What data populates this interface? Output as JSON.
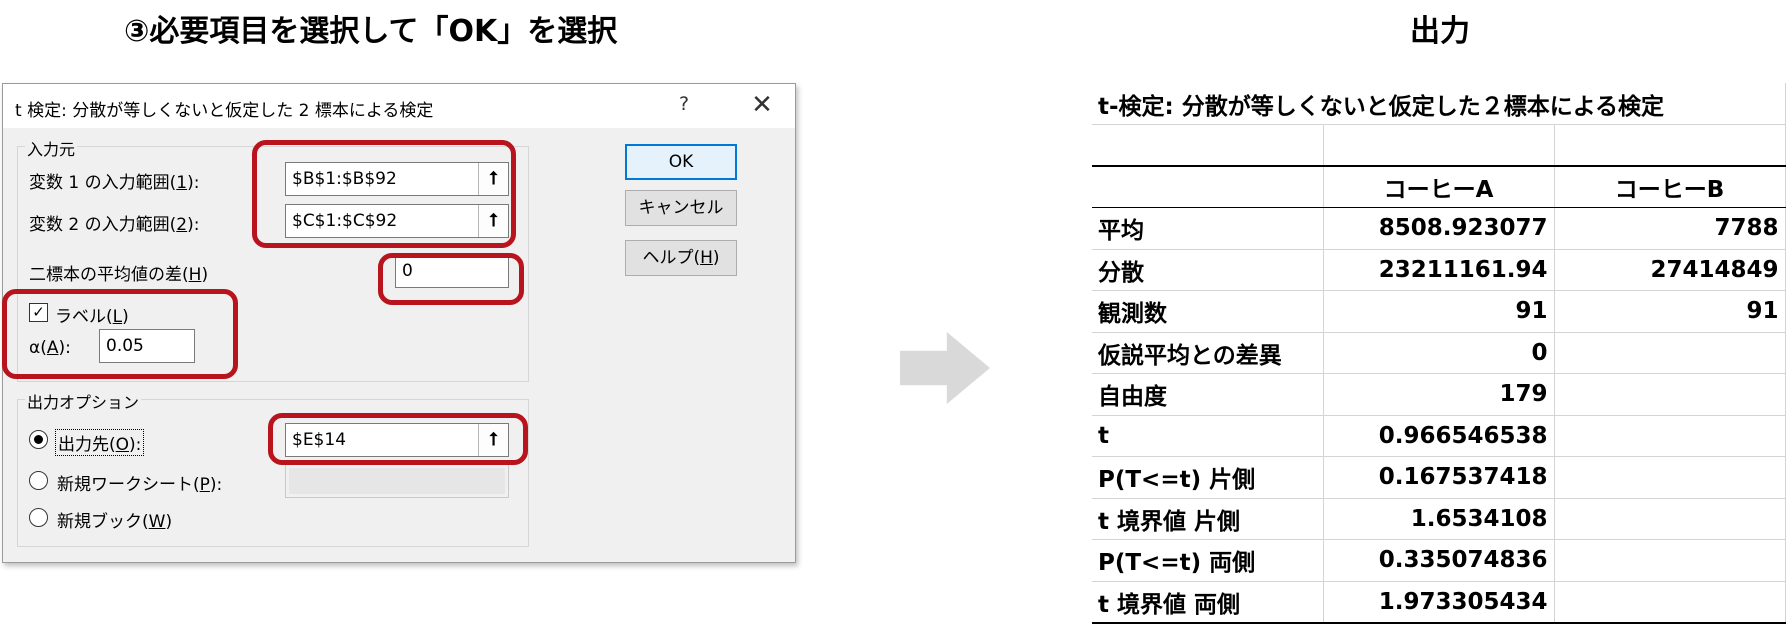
{
  "left_heading": "③必要項目を選択して「OK」を選択",
  "right_heading": "出力",
  "dialog": {
    "title": "t 検定:  分散が等しくないと仮定した 2 標本による検定",
    "help_icon": "?",
    "close_icon": "✕",
    "input_group_label": "入力元",
    "var1_label_pre": "変数 1 の入力範囲(",
    "var1_label_key": "1",
    "var1_label_post": "):",
    "var1_value": "$B$1:$B$92",
    "var2_label_pre": "変数 2 の入力範囲(",
    "var2_label_key": "2",
    "var2_label_post": "):",
    "var2_value": "$C$1:$C$92",
    "mean_diff_label_pre": "二標本の平均値の差(",
    "mean_diff_label_key": "H",
    "mean_diff_label_post": ")",
    "mean_diff_value": "0",
    "labels_checkbox_pre": "ラベル(",
    "labels_checkbox_key": "L",
    "labels_checkbox_post": ")",
    "labels_checked": true,
    "alpha_label_pre": "α(",
    "alpha_label_key": "A",
    "alpha_label_post": "):",
    "alpha_value": "0.05",
    "output_group_label": "出力オプション",
    "output_dest_pre": "出力先(",
    "output_dest_key": "O",
    "output_dest_post": "):",
    "output_dest_value": "$E$14",
    "new_sheet_pre": "新規ワークシート(",
    "new_sheet_key": "P",
    "new_sheet_post": "):",
    "new_book_pre": "新規ブック(",
    "new_book_key": "W",
    "new_book_post": ")",
    "selected_output": "出力先",
    "collapse_icon": "⭡",
    "ok_label": "OK",
    "cancel_label": "キャンセル",
    "help_label_pre": "ヘルプ(",
    "help_label_key": "H",
    "help_label_post": ")"
  },
  "highlight_color": "#b8141e",
  "output": {
    "title": "t-検定: 分散が等しくないと仮定した２標本による検定",
    "col_a": "コーヒーA",
    "col_b": "コーヒーB",
    "rows": [
      {
        "label": "平均",
        "a": "8508.923077",
        "b": "7788"
      },
      {
        "label": "分散",
        "a": "23211161.94",
        "b": "27414849"
      },
      {
        "label": "観測数",
        "a": "91",
        "b": "91"
      },
      {
        "label": "仮説平均との差異",
        "a": "0",
        "b": ""
      },
      {
        "label": "自由度",
        "a": "179",
        "b": ""
      },
      {
        "label": "t",
        "a": "0.966546538",
        "b": ""
      },
      {
        "label": "P(T<=t) 片側",
        "a": "0.167537418",
        "b": ""
      },
      {
        "label": "t 境界値 片側",
        "a": "1.6534108",
        "b": ""
      },
      {
        "label": "P(T<=t) 両側",
        "a": "0.335074836",
        "b": ""
      },
      {
        "label": "t 境界値 両側",
        "a": "1.973305434",
        "b": ""
      }
    ]
  }
}
